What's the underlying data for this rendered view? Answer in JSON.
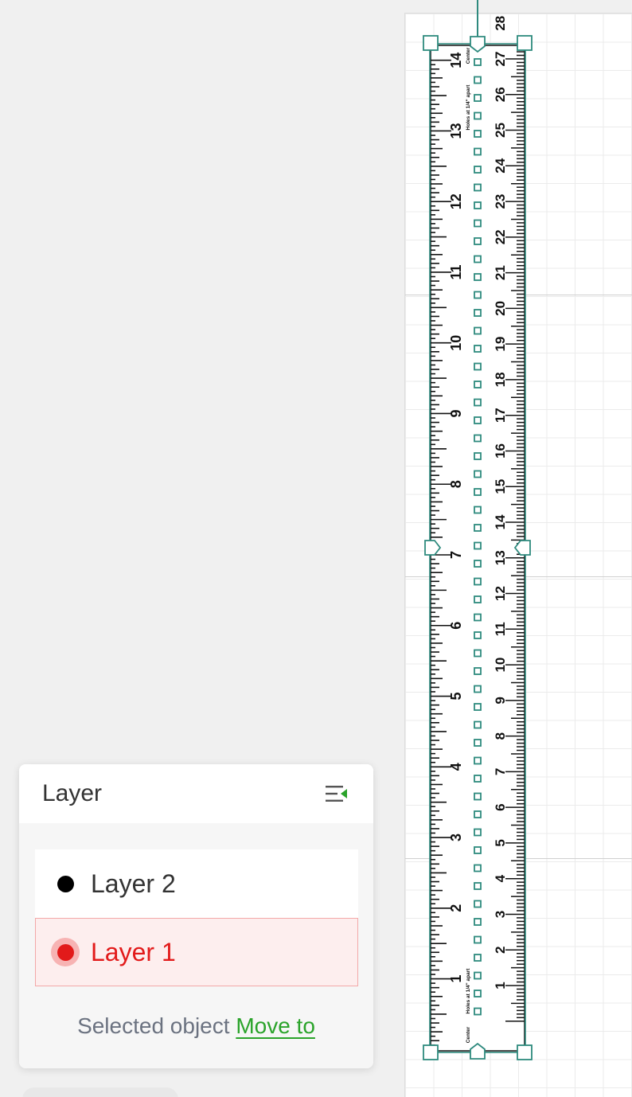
{
  "layer_panel": {
    "title": "Layer",
    "collapse_icon": "collapse-panel-icon",
    "layers": [
      {
        "name": "Layer 2",
        "color": "#000000",
        "active": false
      },
      {
        "name": "Layer 1",
        "color": "#e21a1a",
        "active": true
      }
    ],
    "footer_text": "Selected object",
    "footer_link": "Move to"
  },
  "ruler": {
    "inch_labels": [
      "14",
      "13",
      "12",
      "11",
      "10",
      "9",
      "8",
      "7",
      "6",
      "5",
      "4",
      "3",
      "2",
      "1"
    ],
    "cm_labels": [
      "28",
      "27",
      "26",
      "25",
      "24",
      "23",
      "22",
      "21",
      "20",
      "19",
      "18",
      "17",
      "16",
      "15",
      "14",
      "13",
      "12",
      "11",
      "10",
      "9",
      "8",
      "7",
      "6",
      "5",
      "4",
      "3",
      "2",
      "1"
    ],
    "holes_label": "Holes at 1/4\" apart",
    "center_label": "Center"
  },
  "colors": {
    "selection": "#2e8a7e",
    "active_layer": "#e21a1a",
    "link": "#2aa32a"
  }
}
